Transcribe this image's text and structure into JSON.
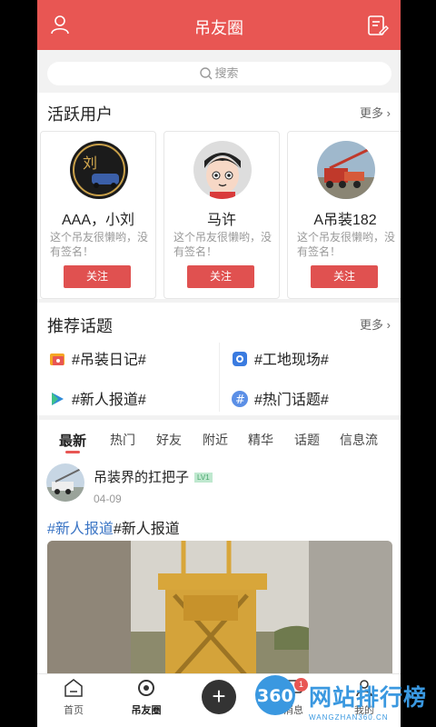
{
  "header": {
    "title": "吊友圈"
  },
  "search": {
    "placeholder": "搜索"
  },
  "active_users": {
    "title": "活跃用户",
    "more": "更多",
    "users": [
      {
        "name": "AAA，小刘",
        "signature": "这个吊友很懒哟，没有签名！",
        "follow": "关注"
      },
      {
        "name": "马许",
        "signature": "这个吊友很懒哟，没有签名！",
        "follow": "关注"
      },
      {
        "name": "A吊装182",
        "signature": "这个吊友很懒哟，没有签名！",
        "follow": "关注"
      }
    ]
  },
  "topics": {
    "title": "推荐话题",
    "more": "更多",
    "items": [
      "#吊装日记#",
      "#工地现场#",
      "#新人报道#",
      "#热门话题#"
    ]
  },
  "tabs": [
    "最新",
    "热门",
    "好友",
    "附近",
    "精华",
    "话题",
    "信息流"
  ],
  "post": {
    "author": "吊装界的扛把子",
    "level": "LV1",
    "date": "04-09",
    "tag": "#新人报道",
    "text": "#新人报道"
  },
  "bottom_nav": {
    "home": "首页",
    "circle": "吊友圈",
    "messages": "消息",
    "mine": "我的",
    "badge": "1"
  },
  "watermark": {
    "text": "网站排行榜",
    "sub": "WANGZHAN360.CN",
    "num": "360"
  },
  "colors": {
    "brand": "#e85653",
    "tag": "#3a74c4"
  }
}
